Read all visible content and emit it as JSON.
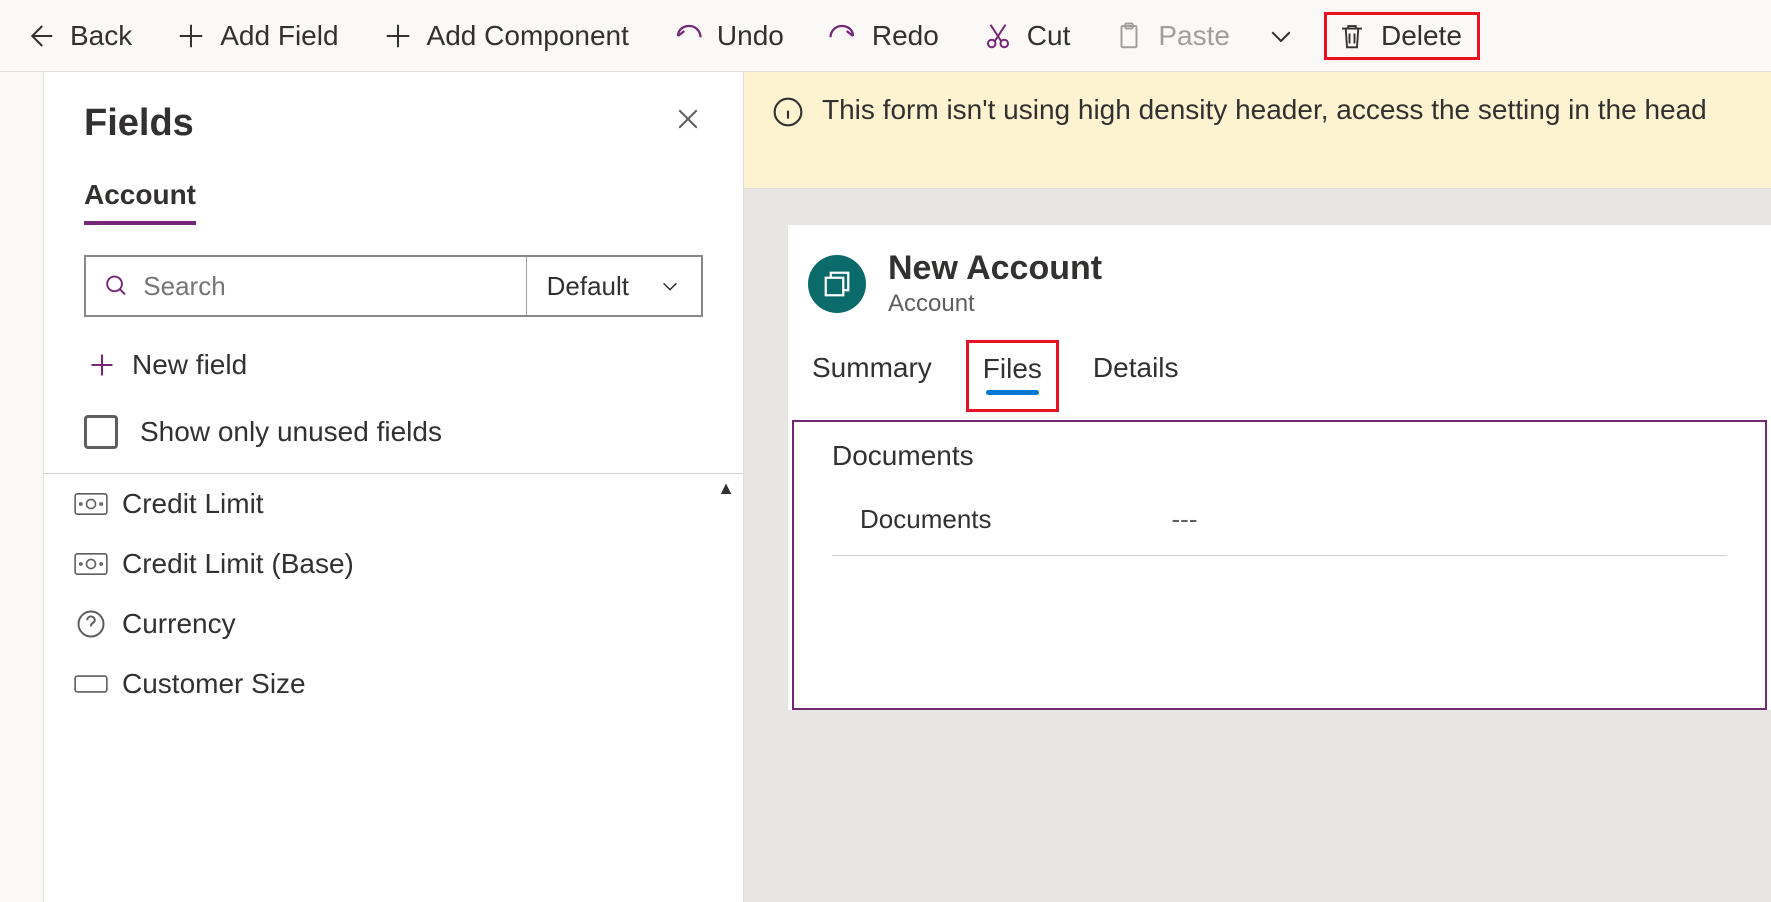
{
  "toolbar": {
    "back": "Back",
    "add_field": "Add Field",
    "add_component": "Add Component",
    "undo": "Undo",
    "redo": "Redo",
    "cut": "Cut",
    "paste": "Paste",
    "delete": "Delete"
  },
  "fields_panel": {
    "title": "Fields",
    "entity_tab": "Account",
    "search_placeholder": "Search",
    "filter_label": "Default",
    "new_field": "New field",
    "unused_label": "Show only unused fields",
    "items": [
      {
        "label": "Credit Limit",
        "icon": "currency"
      },
      {
        "label": "Credit Limit (Base)",
        "icon": "currency"
      },
      {
        "label": "Currency",
        "icon": "help"
      },
      {
        "label": "Customer Size",
        "icon": "option"
      }
    ]
  },
  "banner": {
    "text": "This form isn't using high density header, access the setting in the head"
  },
  "form": {
    "title": "New Account",
    "subtitle": "Account",
    "tabs": [
      {
        "label": "Summary",
        "active": false
      },
      {
        "label": "Files",
        "active": true
      },
      {
        "label": "Details",
        "active": false
      }
    ],
    "section_title": "Documents",
    "row_label": "Documents",
    "row_value": "---"
  }
}
